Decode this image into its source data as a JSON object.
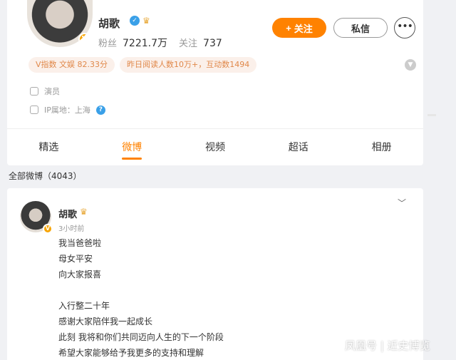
{
  "profile": {
    "name": "胡歌",
    "fans_label": "粉丝",
    "fans_value": "7221.7万",
    "follow_label": "关注",
    "follow_value": "737",
    "follow_button": "关注",
    "message_button": "私信",
    "more_button": "•••",
    "verified_badge": "V",
    "tag_vindex": "V指数 文娱 82.33分",
    "tag_reads": "昨日阅读人数10万+，互动数1494",
    "occupation": "演员",
    "ip_location": "IP属地：上海"
  },
  "tabs": [
    "精选",
    "微博",
    "视频",
    "超话",
    "相册"
  ],
  "active_tab": "微博",
  "all_posts_label": "全部微博（4043）",
  "post": {
    "author": "胡歌",
    "time": "3小时前",
    "lines": [
      "我当爸爸啦",
      "母女平安",
      "向大家报喜",
      "",
      "入行整二十年",
      "感谢大家陪伴我一起成长",
      "此刻 我将和你们共同迈向人生的下一个阶段",
      "希望大家能够给予我更多的支持和理解"
    ]
  },
  "watermark": "凤凰号 | 近史博览",
  "colors": {
    "accent": "#ff8200",
    "tag_bg": "#fbf0ea",
    "tag_text": "#e0884a",
    "verified": "#f7a400",
    "background": "#f0f1f4"
  },
  "icons": {
    "verified": "verified-v-icon",
    "vip": "crown-icon",
    "blue_badge": "blue-verify-icon",
    "occupation": "occupation-icon",
    "help": "help-icon",
    "expand": "chevron-down-icon"
  }
}
